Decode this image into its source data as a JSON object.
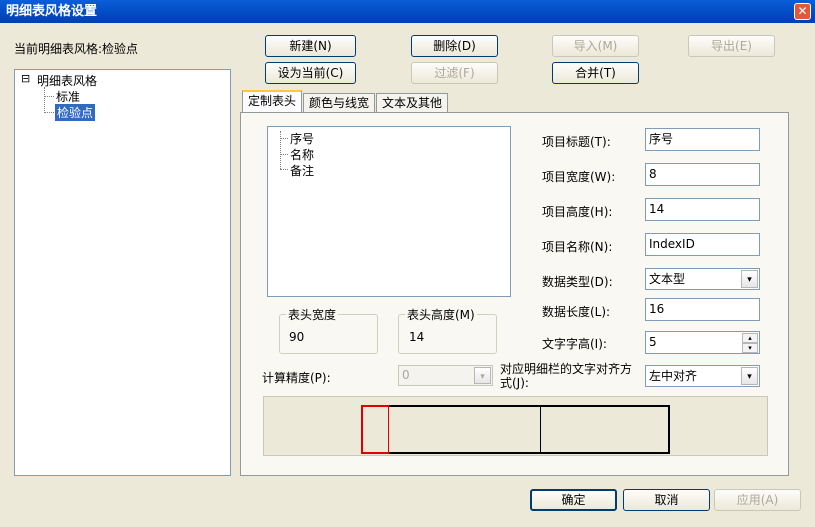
{
  "window": {
    "title": "明细表风格设置",
    "close_glyph": "✕"
  },
  "current_style_label": "当前明细表风格:检验点",
  "toolbar": {
    "new": "新建(N)",
    "set_current": "设为当前(C)",
    "delete": "删除(D)",
    "filter": "过滤(F)",
    "import": "导入(M)",
    "merge": "合并(T)",
    "export": "导出(E)"
  },
  "tree": {
    "root": "明细表风格",
    "expander": "⊟",
    "children": [
      "标准",
      "检验点"
    ],
    "selected": "检验点"
  },
  "tabs": [
    "定制表头",
    "颜色与线宽",
    "文本及其他"
  ],
  "active_tab": "定制表头",
  "header_items": [
    "序号",
    "名称",
    "备注"
  ],
  "fields": {
    "title_label": "项目标题(T):",
    "title_value": "序号",
    "width_label": "项目宽度(W):",
    "width_value": "8",
    "height_label": "项目高度(H):",
    "height_value": "14",
    "name_label": "项目名称(N):",
    "name_value": "IndexID",
    "dtype_label": "数据类型(D):",
    "dtype_value": "文本型",
    "dlen_label": "数据长度(L):",
    "dlen_value": "16",
    "fontheight_label": "文字字高(I):",
    "fontheight_value": "5",
    "precision_label": "计算精度(P):",
    "precision_value": "0",
    "align_label_line1": "对应明细栏的文字对齐方",
    "align_label_line2": "式(J):",
    "align_value": "左中对齐"
  },
  "header_size": {
    "width_title": "表头宽度",
    "width_value": "90",
    "height_title": "表头高度(M)",
    "height_value": "14"
  },
  "footer": {
    "ok": "确定",
    "cancel": "取消",
    "apply": "应用(A)"
  },
  "colors": {
    "titlebar": "#0450c9",
    "dialog_bg": "#ece9d8",
    "selection": "#316ac5",
    "preview_highlight": "#e00000"
  },
  "icons": {
    "dropdown": "▾",
    "spin_up": "▴",
    "spin_down": "▾"
  }
}
